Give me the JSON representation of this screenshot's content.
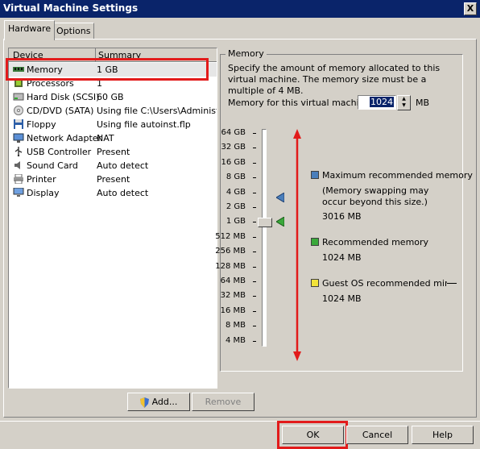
{
  "window": {
    "title": "Virtual Machine Settings",
    "close": "X"
  },
  "tabs": [
    {
      "label": "Hardware"
    },
    {
      "label": "Options"
    }
  ],
  "devices": {
    "col_device": "Device",
    "col_summary": "Summary",
    "items": [
      {
        "name": "Memory",
        "summary": "1 GB",
        "icon": "memory-icon"
      },
      {
        "name": "Processors",
        "summary": "1",
        "icon": "processor-icon"
      },
      {
        "name": "Hard Disk (SCSI)",
        "summary": "60 GB",
        "icon": "hard-disk-icon"
      },
      {
        "name": "CD/DVD (SATA)",
        "summary": "Using file C:\\Users\\Administrat",
        "icon": "cd-dvd-icon"
      },
      {
        "name": "Floppy",
        "summary": "Using file autoinst.flp",
        "icon": "floppy-icon"
      },
      {
        "name": "Network Adapter",
        "summary": "NAT",
        "icon": "network-adapter-icon"
      },
      {
        "name": "USB Controller",
        "summary": "Present",
        "icon": "usb-icon"
      },
      {
        "name": "Sound Card",
        "summary": "Auto detect",
        "icon": "sound-card-icon"
      },
      {
        "name": "Printer",
        "summary": "Present",
        "icon": "printer-icon"
      },
      {
        "name": "Display",
        "summary": "Auto detect",
        "icon": "display-icon"
      }
    ],
    "add_label": "Add...",
    "remove_label": "Remove"
  },
  "memory": {
    "group_title": "Memory",
    "description": "Specify the amount of memory allocated to this virtual machine. The memory size must be a multiple of 4 MB.",
    "field_label": "Memory for this virtual machine:",
    "value": "1024",
    "unit": "MB",
    "scale": [
      "64 GB",
      "32 GB",
      "16 GB",
      "8 GB",
      "4 GB",
      "2 GB",
      "1 GB",
      "512 MB",
      "256 MB",
      "128 MB",
      "64 MB",
      "32 MB",
      "16 MB",
      "8 MB",
      "4 MB"
    ],
    "legend": {
      "max_title": "Maximum recommended memory",
      "max_note": "(Memory swapping may occur beyond this size.)",
      "max_value": "3016 MB",
      "rec_title": "Recommended memory",
      "rec_value": "1024 MB",
      "guest_title": "Guest OS recommended minimum",
      "guest_value": "1024 MB"
    },
    "colors": {
      "max": "#4a7ebb",
      "rec": "#3aa83a",
      "guest": "#f2e33a"
    }
  },
  "buttons": {
    "ok": "OK",
    "cancel": "Cancel",
    "help": "Help"
  },
  "annotation_color": "#e21b1b"
}
